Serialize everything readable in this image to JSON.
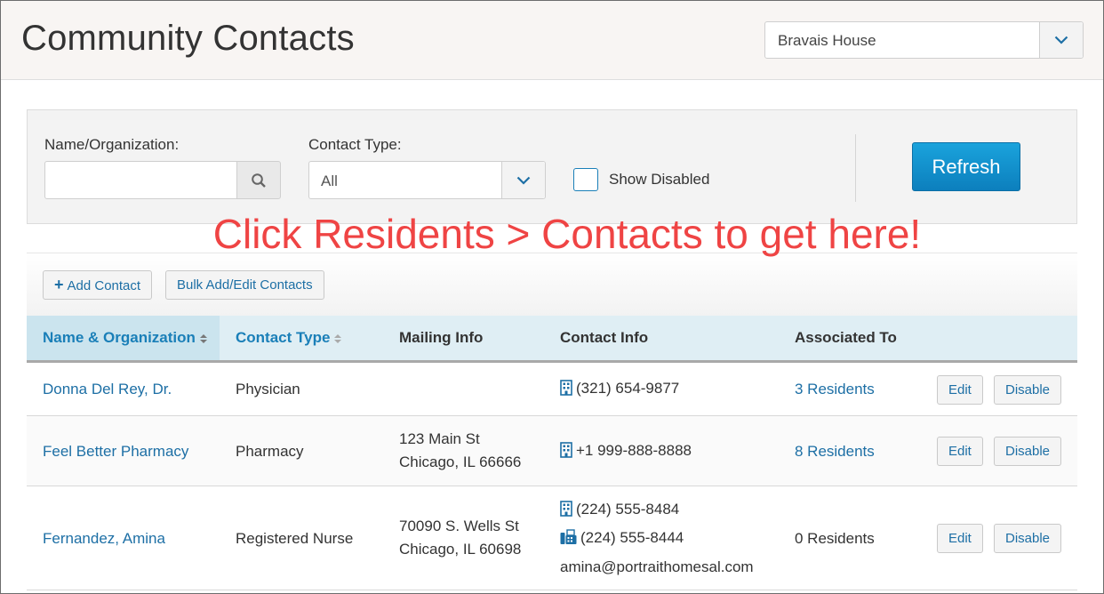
{
  "header": {
    "title": "Community Contacts",
    "house_select": "Bravais House"
  },
  "filters": {
    "name_label": "Name/Organization:",
    "name_value": "",
    "type_label": "Contact Type:",
    "type_value": "All",
    "show_disabled_label": "Show Disabled",
    "show_disabled_checked": false,
    "refresh_label": "Refresh"
  },
  "annotation": "Click Residents > Contacts to get here!",
  "toolbar": {
    "add_contact_label": "Add Contact",
    "bulk_label": "Bulk Add/Edit Contacts"
  },
  "table": {
    "columns": [
      "Name & Organization",
      "Contact Type",
      "Mailing Info",
      "Contact Info",
      "Associated To"
    ],
    "rows": [
      {
        "name": "Donna Del Rey, Dr.",
        "type": "Physician",
        "mailing_line1": "",
        "mailing_line2": "",
        "phone": "(321) 654-9877",
        "associated": "3 Residents",
        "edit": "Edit",
        "disable": "Disable"
      },
      {
        "name": "Feel Better Pharmacy",
        "type": "Pharmacy",
        "mailing_line1": "123 Main St",
        "mailing_line2": "Chicago, IL 66666",
        "phone": "+1 999-888-8888",
        "associated": "8 Residents",
        "edit": "Edit",
        "disable": "Disable"
      },
      {
        "name": "Fernandez, Amina",
        "type": "Registered Nurse",
        "mailing_line1": "70090 S. Wells St",
        "mailing_line2": "Chicago, IL 60698",
        "phone": "(224) 555-8484",
        "fax": "(224) 555-8444",
        "email": "amina@portraithomesal.com",
        "associated": "0 Residents",
        "edit": "Edit",
        "disable": "Disable"
      }
    ]
  },
  "colors": {
    "accent": "#1a7fb8",
    "link": "#1d6fa5",
    "annotation": "#ef4444",
    "header_bg": "#dfeef4"
  }
}
